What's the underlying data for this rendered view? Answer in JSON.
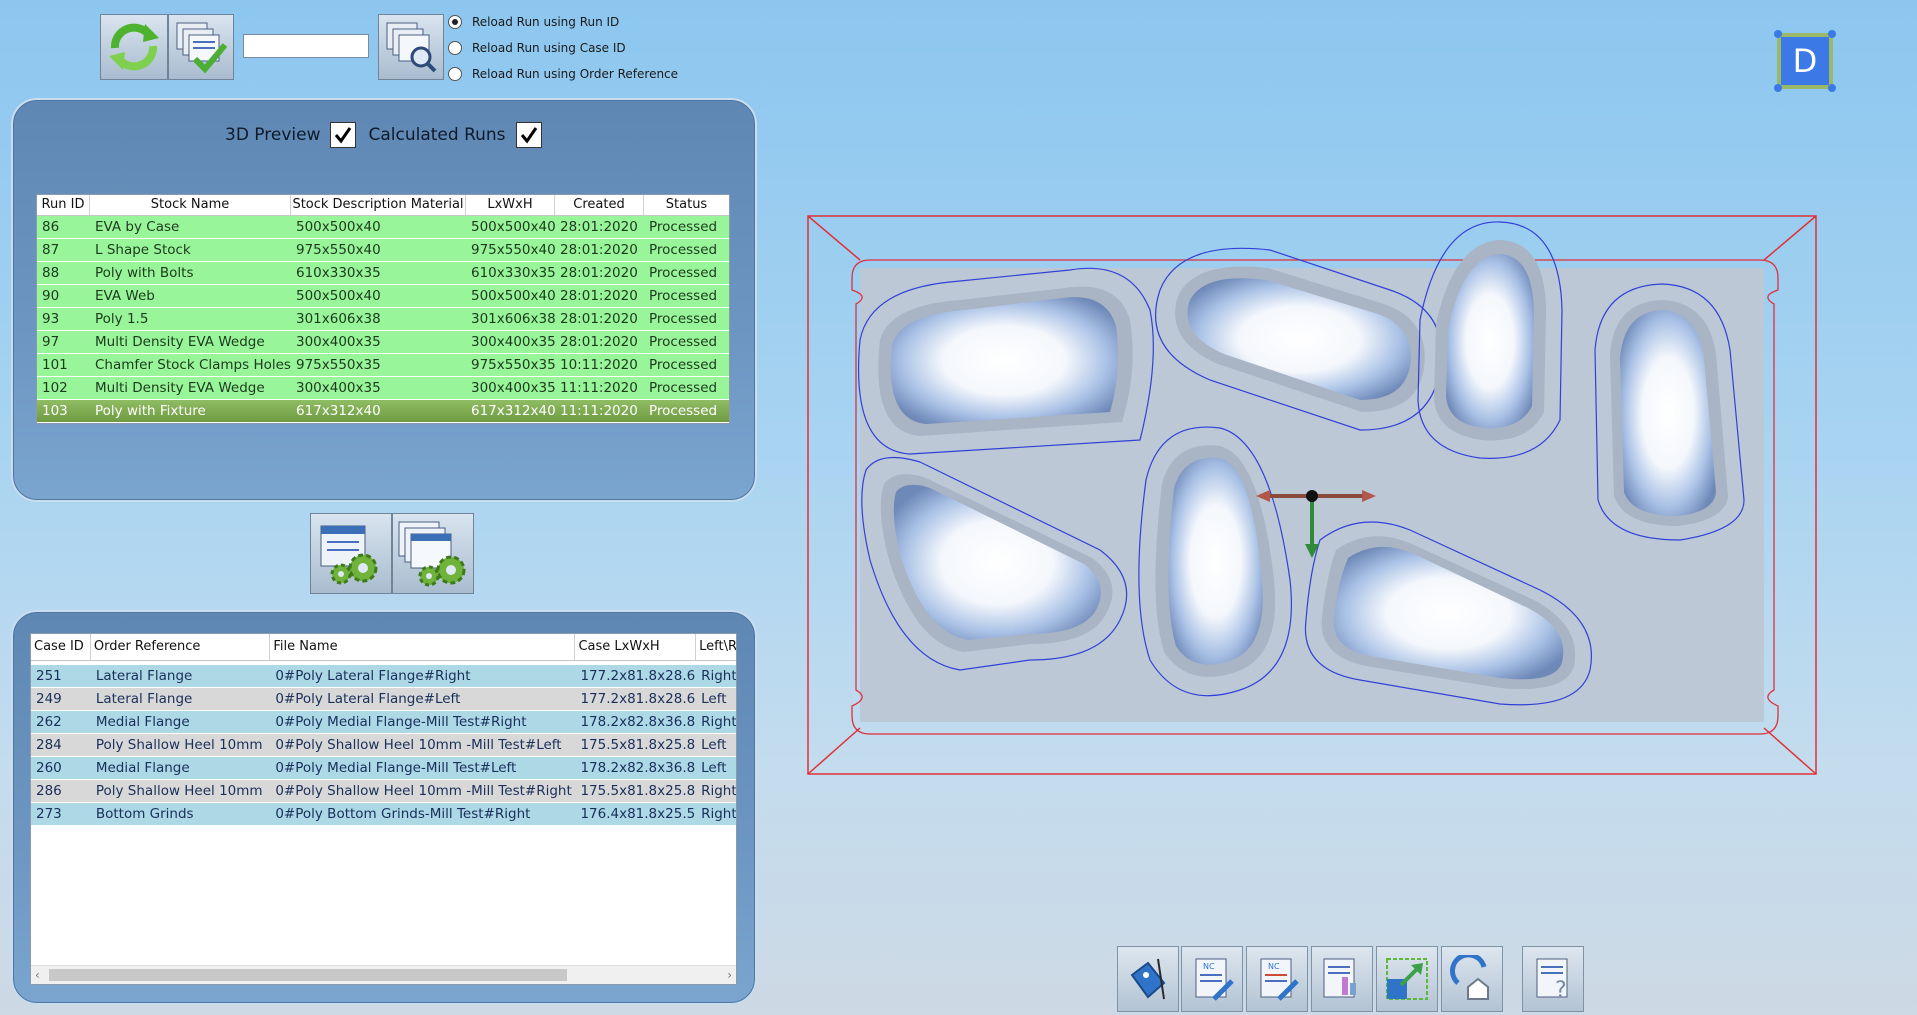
{
  "toolbar": {
    "search_value": "",
    "reload_options": [
      "Reload Run using Run ID",
      "Reload Run using Case ID",
      "Reload Run using Order Reference"
    ],
    "reload_selected": 0
  },
  "user_badge": {
    "letter": "D",
    "color": "#3a79e6"
  },
  "runs_panel": {
    "preview_label": "3D Preview",
    "preview_checked": true,
    "calculated_label": "Calculated Runs",
    "calculated_checked": true,
    "columns": [
      "Run ID",
      "Stock Name",
      "Stock Description Material",
      "LxWxH",
      "Created",
      "Status"
    ],
    "rows": [
      {
        "run_id": "86",
        "stock_name": "EVA by Case",
        "material": "500x500x40",
        "lwh": "500x500x40",
        "created": "28:01:2020",
        "status": "Processed"
      },
      {
        "run_id": "87",
        "stock_name": "L Shape Stock",
        "material": "975x550x40",
        "lwh": "975x550x40",
        "created": "28:01:2020",
        "status": "Processed"
      },
      {
        "run_id": "88",
        "stock_name": "Poly with Bolts",
        "material": "610x330x35",
        "lwh": "610x330x35",
        "created": "28:01:2020",
        "status": "Processed"
      },
      {
        "run_id": "90",
        "stock_name": "EVA Web",
        "material": "500x500x40",
        "lwh": "500x500x40",
        "created": "28:01:2020",
        "status": "Processed"
      },
      {
        "run_id": "93",
        "stock_name": "Poly 1.5",
        "material": "301x606x38",
        "lwh": "301x606x38",
        "created": "28:01:2020",
        "status": "Processed"
      },
      {
        "run_id": "97",
        "stock_name": "Multi Density EVA Wedge",
        "material": "300x400x35",
        "lwh": "300x400x35",
        "created": "28:01:2020",
        "status": "Processed"
      },
      {
        "run_id": "101",
        "stock_name": "Chamfer Stock Clamps Holes",
        "material": "975x550x35",
        "lwh": "975x550x35",
        "created": "10:11:2020",
        "status": "Processed"
      },
      {
        "run_id": "102",
        "stock_name": "Multi Density EVA Wedge",
        "material": "300x400x35",
        "lwh": "300x400x35",
        "created": "11:11:2020",
        "status": "Processed"
      },
      {
        "run_id": "103",
        "stock_name": "Poly with Fixture",
        "material": "617x312x40",
        "lwh": "617x312x40",
        "created": "11:11:2020",
        "status": "Processed"
      }
    ],
    "selected_row": 8
  },
  "cases_panel": {
    "columns": [
      "Case ID",
      "Order Reference",
      "File Name",
      "Case LxWxH",
      "Left\\R"
    ],
    "rows": [
      {
        "case_id": "251",
        "order_ref": "Lateral Flange",
        "file": "0#Poly Lateral Flange#Right",
        "lwh": "177.2x81.8x28.6",
        "side": "Right"
      },
      {
        "case_id": "249",
        "order_ref": "Lateral Flange",
        "file": "0#Poly Lateral Flange#Left",
        "lwh": "177.2x81.8x28.6",
        "side": "Left"
      },
      {
        "case_id": "262",
        "order_ref": "Medial Flange",
        "file": "0#Poly Medial Flange-Mill Test#Right",
        "lwh": "178.2x82.8x36.8",
        "side": "Right"
      },
      {
        "case_id": "284",
        "order_ref": "Poly Shallow Heel 10mm",
        "file": "0#Poly Shallow Heel 10mm -Mill Test#Left",
        "lwh": "175.5x81.8x25.8",
        "side": "Left"
      },
      {
        "case_id": "260",
        "order_ref": "Medial Flange",
        "file": "0#Poly Medial Flange-Mill Test#Left",
        "lwh": "178.2x82.8x36.8",
        "side": "Left"
      },
      {
        "case_id": "286",
        "order_ref": "Poly Shallow Heel 10mm",
        "file": "0#Poly Shallow Heel 10mm -Mill Test#Right",
        "lwh": "175.5x81.8x25.8",
        "side": "Right"
      },
      {
        "case_id": "273",
        "order_ref": "Bottom Grinds",
        "file": "0#Poly Bottom Grinds-Mill Test#Right",
        "lwh": "176.4x81.8x25.5",
        "side": "Right"
      }
    ]
  },
  "bottom_toolbar": {
    "icons": [
      "tag-icon",
      "nc-edit-icon",
      "nc-export-icon",
      "report-icon",
      "resize-icon",
      "home-icon",
      "help-icon"
    ]
  }
}
